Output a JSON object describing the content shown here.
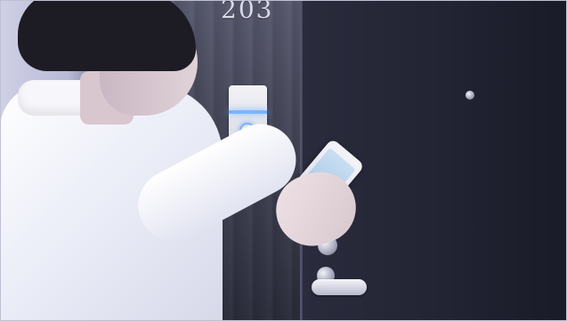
{
  "scene": {
    "room_number": "203",
    "colors": {
      "lock_glow": "#7bb5ff",
      "door": "#222333",
      "wall": "#43455b",
      "shirt": "#f3f4fb"
    }
  }
}
